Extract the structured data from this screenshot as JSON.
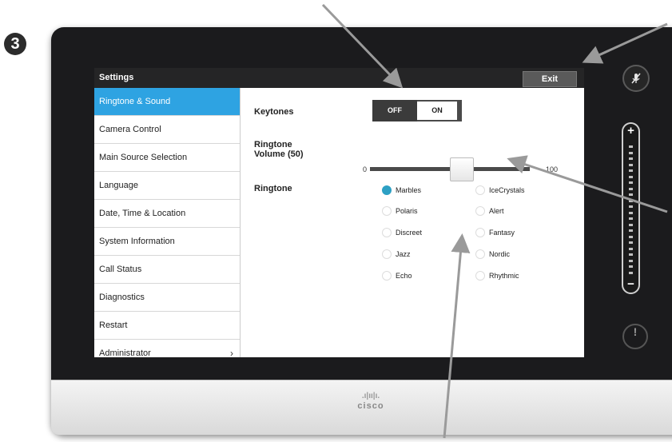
{
  "step_badge": "3",
  "window": {
    "title": "Settings",
    "exit_label": "Exit"
  },
  "sidebar": {
    "items": [
      {
        "label": "Ringtone & Sound",
        "active": true
      },
      {
        "label": "Camera Control"
      },
      {
        "label": "Main Source Selection"
      },
      {
        "label": "Language"
      },
      {
        "label": "Date, Time & Location"
      },
      {
        "label": "System Information"
      },
      {
        "label": "Call Status"
      },
      {
        "label": "Diagnostics"
      },
      {
        "label": "Restart"
      },
      {
        "label": "Administrator"
      }
    ]
  },
  "keytones": {
    "label": "Keytones",
    "off_label": "OFF",
    "on_label": "ON",
    "value": "OFF"
  },
  "volume": {
    "label_line1": "Ringtone",
    "label_line2": "Volume (50)",
    "min": "0",
    "max": "100",
    "value": 50
  },
  "ringtone": {
    "label": "Ringtone",
    "selected": "Marbles",
    "options": [
      "Marbles",
      "IceCrystals",
      "Polaris",
      "Alert",
      "Discreet",
      "Fantasy",
      "Jazz",
      "Nordic",
      "Echo",
      "Rhythmic"
    ]
  },
  "device": {
    "brand": "cisco",
    "brand_bars": ".ı|ıı|ı."
  },
  "icons": {
    "mute": "mic-muted-icon",
    "volume_up": "plus-icon",
    "volume_down": "minus-icon",
    "alert": "exclamation-icon"
  },
  "colors": {
    "accent": "#2ea3e2",
    "radio_selected": "#2da0c4",
    "bezel": "#1b1b1d",
    "titlebar": "#252526"
  }
}
